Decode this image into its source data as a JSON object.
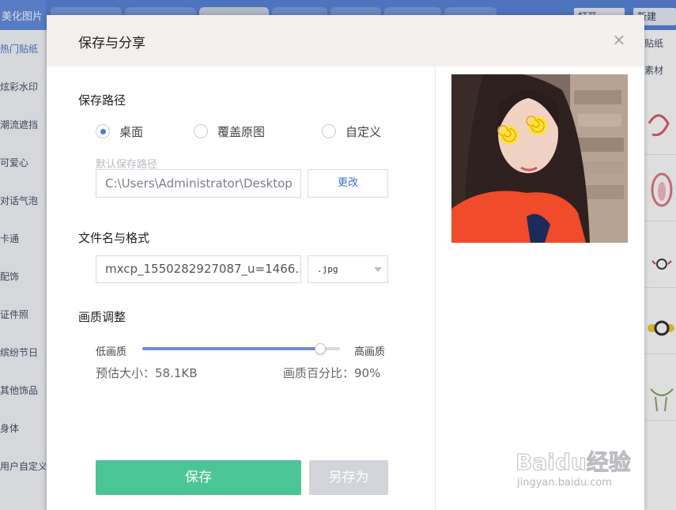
{
  "app": {
    "current_category": "美化图片",
    "top_right_buttons": [
      "打开",
      "新建"
    ]
  },
  "sidebar": {
    "items": [
      {
        "label": "热门贴纸",
        "active": true
      },
      {
        "label": "炫彩水印"
      },
      {
        "label": "潮流遮挡"
      },
      {
        "label": "可爱心"
      },
      {
        "label": "对话气泡"
      },
      {
        "label": "卡通"
      },
      {
        "label": "配饰"
      },
      {
        "label": "证件照"
      },
      {
        "label": "缤纷节日"
      },
      {
        "label": "其他饰品"
      },
      {
        "label": "身体"
      },
      {
        "label": "用户自定义"
      }
    ]
  },
  "right_panel": {
    "labels": [
      "贴纸",
      "素材"
    ]
  },
  "dialog": {
    "title": "保存与分享",
    "close_icon": "close-icon",
    "save_path": {
      "title": "保存路径",
      "options": [
        {
          "label": "桌面",
          "checked": true
        },
        {
          "label": "覆盖原图",
          "checked": false
        },
        {
          "label": "自定义",
          "checked": false
        }
      ],
      "hint": "默认保存路径",
      "path_value": "C:\\Users\\Administrator\\Desktop",
      "change_label": "更改"
    },
    "file": {
      "title": "文件名与格式",
      "filename_value": "mxcp_1550282927087_u=1466...",
      "format_value": ".jpg"
    },
    "quality": {
      "title": "画质调整",
      "low_label": "低画质",
      "high_label": "高画质",
      "value_fraction": 0.9,
      "estimated_size": "预估大小：58.1KB",
      "percent_text": "画质百分比：90%"
    },
    "buttons": {
      "save": "保存",
      "save_as": "另存为"
    }
  },
  "watermark": {
    "brand": "Baidu经验",
    "url": "jingyan.baidu.com"
  },
  "colors": {
    "accent": "#4d79d9",
    "save_green": "#4bc496",
    "topbar_blue": "#4f7ed6"
  }
}
